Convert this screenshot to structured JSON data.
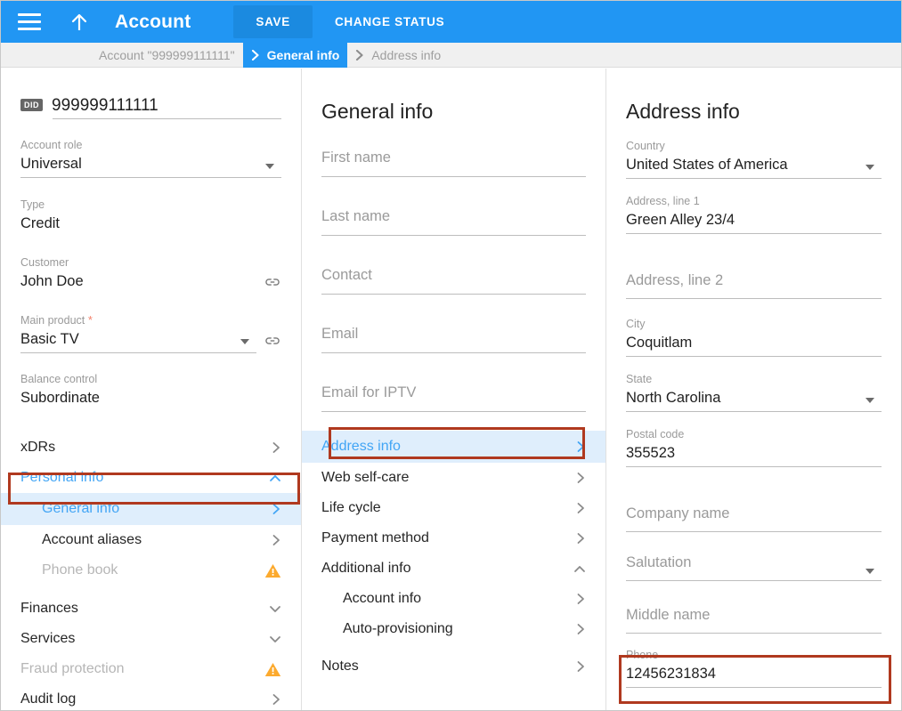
{
  "topbar": {
    "menu_icon": "hamburger-icon",
    "up_icon": "arrow-up-icon",
    "title": "Account",
    "save_label": "SAVE",
    "change_status_label": "CHANGE STATUS",
    "background": "#2196f3",
    "save_background": "#1b8ae0"
  },
  "breadcrumb": {
    "items": [
      {
        "label": "Account \"999999111111\"",
        "active": false,
        "chevron": false
      },
      {
        "label": "General info",
        "active": true,
        "chevron": true
      },
      {
        "label": "Address info",
        "active": false,
        "chevron": true
      }
    ]
  },
  "left_panel": {
    "did_badge": "DID",
    "did_value": "999999111111",
    "fields": [
      {
        "label": "Account role",
        "value": "Universal",
        "caret": true,
        "chain": false
      },
      {
        "label": "Type",
        "value": "Credit",
        "caret": false,
        "chain": false
      },
      {
        "label": "Customer",
        "value": "John Doe",
        "caret": false,
        "chain": true
      },
      {
        "label": "Main product",
        "required": true,
        "value": "Basic TV",
        "caret": true,
        "chain": true
      },
      {
        "label": "Balance control",
        "value": "Subordinate",
        "caret": false,
        "chain": false
      }
    ],
    "nav": [
      {
        "label": "xDRs",
        "icon": "chevron-right-icon",
        "state": "normal",
        "indent": false
      },
      {
        "label": "Personal info",
        "icon": "chevron-up-icon",
        "state": "blue",
        "indent": false
      },
      {
        "label": "General info",
        "icon": "chevron-right-icon",
        "state": "selected",
        "indent": true
      },
      {
        "label": "Account aliases",
        "icon": "chevron-right-icon",
        "state": "normal",
        "indent": true
      },
      {
        "label": "Phone book",
        "icon": "warning-icon",
        "state": "muted",
        "indent": true
      },
      {
        "label": "Finances",
        "icon": "chevron-down-icon",
        "state": "normal",
        "indent": false
      },
      {
        "label": "Services",
        "icon": "chevron-down-icon",
        "state": "normal",
        "indent": false
      },
      {
        "label": "Fraud protection",
        "icon": "warning-icon",
        "state": "muted",
        "indent": false
      },
      {
        "label": "Audit log",
        "icon": "chevron-right-icon",
        "state": "normal",
        "indent": false
      }
    ]
  },
  "mid_panel": {
    "title": "General info",
    "fields": [
      {
        "placeholder": "First name",
        "value": ""
      },
      {
        "placeholder": "Last name",
        "value": ""
      },
      {
        "placeholder": "Contact",
        "value": ""
      },
      {
        "placeholder": "Email",
        "value": ""
      },
      {
        "placeholder": "Email for IPTV",
        "value": ""
      }
    ],
    "nav": [
      {
        "label": "Address info",
        "icon": "chevron-right-icon",
        "state": "selected",
        "indent": false
      },
      {
        "label": "Web self-care",
        "icon": "chevron-right-icon",
        "state": "normal",
        "indent": false
      },
      {
        "label": "Life cycle",
        "icon": "chevron-right-icon",
        "state": "normal",
        "indent": false
      },
      {
        "label": "Payment method",
        "icon": "chevron-right-icon",
        "state": "normal",
        "indent": false
      },
      {
        "label": "Additional info",
        "icon": "chevron-up-icon",
        "state": "normal",
        "indent": false
      },
      {
        "label": "Account info",
        "icon": "chevron-right-icon",
        "state": "normal",
        "indent": true
      },
      {
        "label": "Auto-provisioning",
        "icon": "chevron-right-icon",
        "state": "normal",
        "indent": true
      },
      {
        "label": "Notes",
        "icon": "chevron-right-icon",
        "state": "normal",
        "indent": false
      }
    ]
  },
  "right_panel": {
    "title": "Address info",
    "fields": [
      {
        "label": "Country",
        "value": "United States of America",
        "caret": true
      },
      {
        "label": "Address, line 1",
        "value": "Green Alley 23/4",
        "caret": false
      },
      {
        "label": "",
        "placeholder": "Address, line 2",
        "value": "",
        "caret": false
      },
      {
        "label": "City",
        "value": "Coquitlam",
        "caret": false
      },
      {
        "label": "State",
        "value": "North Carolina",
        "caret": true
      },
      {
        "label": "Postal code",
        "value": "355523",
        "caret": false
      },
      {
        "label": "",
        "placeholder": "Company name",
        "value": "",
        "caret": false
      },
      {
        "label": "",
        "placeholder": "Salutation",
        "value": "",
        "caret": true
      },
      {
        "label": "",
        "placeholder": "Middle name",
        "value": "",
        "caret": false
      },
      {
        "label": "Phone",
        "value": "12456231834",
        "caret": false
      }
    ]
  },
  "highlights": {
    "color": "#b0391f",
    "targets": [
      "general-info-nav-row",
      "address-info-nav-row",
      "phone-field"
    ]
  }
}
